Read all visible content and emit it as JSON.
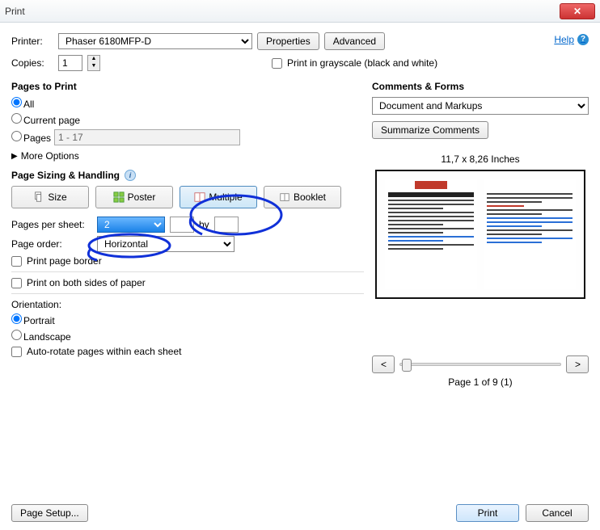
{
  "window": {
    "title": "Print"
  },
  "top": {
    "printer_label": "Printer:",
    "printer": "Phaser 6180MFP-D",
    "properties": "Properties",
    "advanced": "Advanced",
    "copies_label": "Copies:",
    "copies": "1",
    "grayscale": "Print in grayscale (black and white)",
    "help": "Help"
  },
  "pages_to_print": {
    "title": "Pages to Print",
    "all": "All",
    "current": "Current page",
    "pages": "Pages",
    "pages_range": "1 - 17",
    "more": "More Options"
  },
  "sizing": {
    "title": "Page Sizing & Handling",
    "size": "Size",
    "poster": "Poster",
    "multiple": "Multiple",
    "booklet": "Booklet",
    "pps_label": "Pages per sheet:",
    "pps_value": "2",
    "by": "by",
    "order_label": "Page order:",
    "order_value": "Horizontal",
    "print_border": "Print page border",
    "both_sides": "Print on both sides of paper",
    "orientation_label": "Orientation:",
    "portrait": "Portrait",
    "landscape": "Landscape",
    "autorotate": "Auto-rotate pages within each sheet"
  },
  "comments": {
    "title": "Comments & Forms",
    "dropdown": "Document and Markups",
    "summarize": "Summarize Comments"
  },
  "preview": {
    "dims": "11,7 x 8,26 Inches",
    "page_indicator": "Page 1 of 9 (1)",
    "prev": "<",
    "next": ">"
  },
  "footer": {
    "page_setup": "Page Setup...",
    "print": "Print",
    "cancel": "Cancel"
  }
}
